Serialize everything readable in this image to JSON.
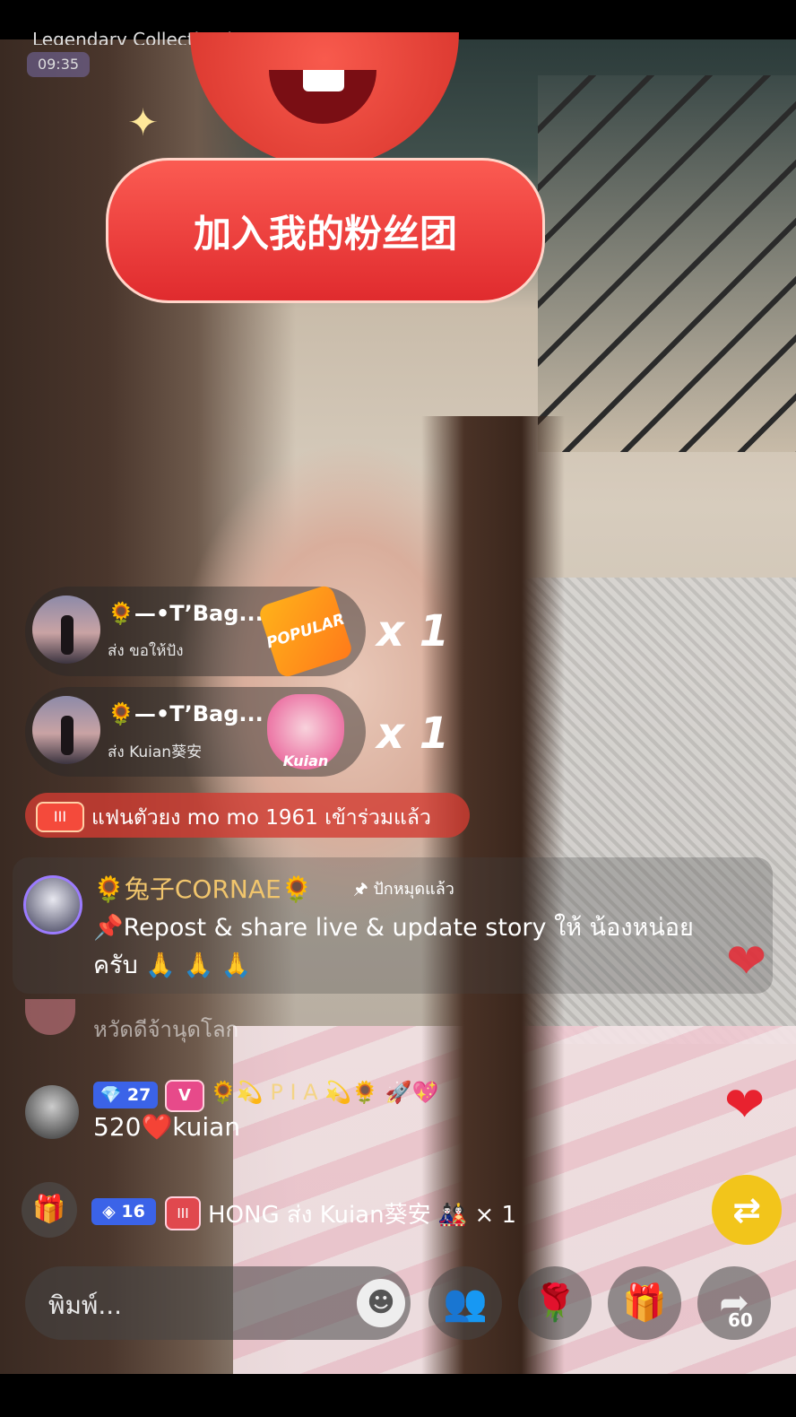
{
  "top_banner": {
    "scrolling_text": "Legendary Collection in",
    "timer": "09:35"
  },
  "fan_club": {
    "label": "加入我的粉丝团"
  },
  "gift_notifications": [
    {
      "name": "🌻—•T’Bag...",
      "sub": "ส่ง ขอให้ปัง",
      "gift_label": "POPULAR",
      "count": "x 1"
    },
    {
      "name": "🌻—•T’Bag...",
      "sub": "ส่ง Kuian葵安",
      "gift_label": "Kuian",
      "count": "x 1"
    }
  ],
  "join_notice": {
    "icon_text": "III",
    "text": "แฟนตัวยง mo mo 1961 เข้าร่วมแล้ว"
  },
  "pinned_comment": {
    "name": "🌻兔子CORNAE🌻",
    "status": "🖈 ปักหมุดแล้ว",
    "message": "📌Repost & share live & update story ให้ น้องหน่อย ครับ 🙏 🙏 🙏"
  },
  "faded_comment": {
    "text": "หวัดดีจ้านุดโลก"
  },
  "comment": {
    "level": "💎 27",
    "vip": "V",
    "name": "🌻💫 P I A 💫🌻 🚀💖",
    "message": "520❤️kuian"
  },
  "gift_line": {
    "icon": "🎁",
    "level": "16",
    "fan_badge": "III",
    "text": "HONG ส่ง Kuian葵安 🎎 × 1"
  },
  "input": {
    "placeholder": "พิมพ์..."
  },
  "bottom_buttons": {
    "emoji": "☻",
    "guests": "👥",
    "rose": "🌹",
    "gift": "🎁",
    "share": "➦",
    "share_count": "60"
  },
  "repost_icon": "⇄",
  "colors": {
    "fan_red": "#e02b2e",
    "level_blue": "#3b63e8",
    "repost_yellow": "#f2c51b",
    "heart_red": "#e8222f"
  }
}
